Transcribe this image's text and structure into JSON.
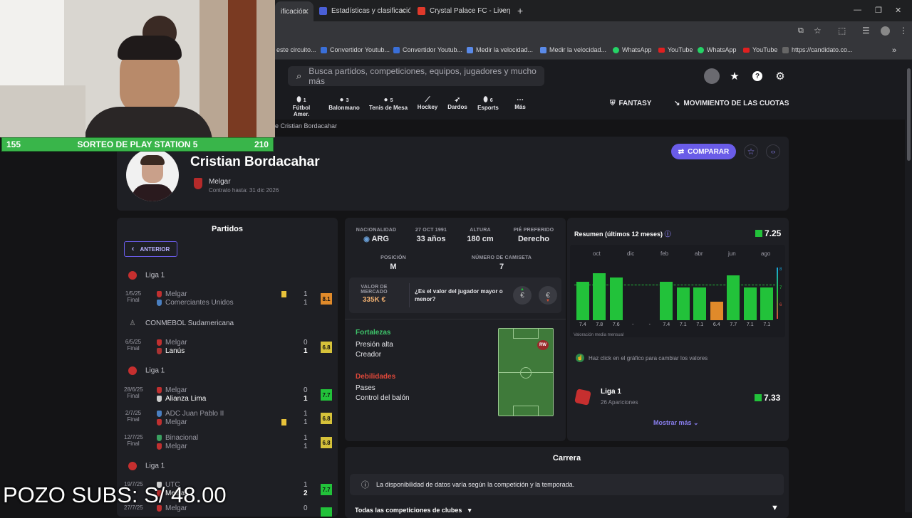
{
  "browser": {
    "tabs": [
      {
        "title": "ificación"
      },
      {
        "title": "Estadísticas y clasificación"
      },
      {
        "title": "Crystal Palace FC - Liverp"
      }
    ],
    "bookmarks": [
      {
        "label": "este circuito..."
      },
      {
        "label": "Convertidor Youtub..."
      },
      {
        "label": "Convertidor Youtub..."
      },
      {
        "label": "Medir la velocidad..."
      },
      {
        "label": "Medir la velocidad..."
      },
      {
        "label": "WhatsApp"
      },
      {
        "label": "YouTube"
      },
      {
        "label": "WhatsApp"
      },
      {
        "label": "YouTube"
      },
      {
        "label": "https://candidato.co..."
      }
    ]
  },
  "overlay": {
    "left_count": "155",
    "banner": "SORTEO DE PLAY STATION 5",
    "right_count": "210",
    "pot": "POZO SUBS: S/ 48.00"
  },
  "header": {
    "search_placeholder": "Busca partidos, competiciones, equipos, jugadores y mucho más",
    "sports": [
      {
        "label": "Fútbol Amer.",
        "count": "1"
      },
      {
        "label": "Balonmano",
        "count": "3"
      },
      {
        "label": "Tenis de Mesa",
        "count": "5"
      },
      {
        "label": "Hockey",
        "count": ""
      },
      {
        "label": "Dardos",
        "count": ""
      },
      {
        "label": "Esports",
        "count": "6"
      },
      {
        "label": "Más",
        "count": ""
      }
    ],
    "fantasy": "FANTASY",
    "odds": "MOVIMIENTO DE LAS CUOTAS"
  },
  "breadcrumb": "e Cristian Bordacahar",
  "player": {
    "name": "Cristian Bordacahar",
    "club": "Melgar",
    "contract": "Contrato hasta: 31 dic 2026",
    "compare": "COMPARAR"
  },
  "matches": {
    "title": "Partidos",
    "prev": "ANTERIOR",
    "groups": [
      {
        "league": "Liga 1",
        "rows": [
          {
            "date": "1/5/25",
            "status": "Final",
            "home": "Melgar",
            "away": "Comerciantes Unidos",
            "hs": "1",
            "as": "1",
            "rating": "8.1",
            "color": "#e08a2a"
          }
        ]
      },
      {
        "league": "CONMEBOL Sudamericana",
        "rows": [
          {
            "date": "6/5/25",
            "status": "Final",
            "home": "Melgar",
            "away": "Lanús",
            "hs": "0",
            "as": "1",
            "rating": "6.8",
            "color": "#d6c23a"
          }
        ]
      },
      {
        "league": "Liga 1",
        "rows": [
          {
            "date": "28/6/25",
            "status": "Final",
            "home": "Melgar",
            "away": "Alianza Lima",
            "hs": "0",
            "as": "1",
            "rating": "7.7",
            "color": "#22c23a"
          },
          {
            "date": "2/7/25",
            "status": "Final",
            "home": "ADC Juan Pablo II",
            "away": "Melgar",
            "hs": "1",
            "as": "1",
            "rating": "6.8",
            "color": "#d6c23a"
          },
          {
            "date": "12/7/25",
            "status": "Final",
            "home": "Binacional",
            "away": "Melgar",
            "hs": "1",
            "as": "1",
            "rating": "6.8",
            "color": "#d6c23a"
          }
        ]
      },
      {
        "league": "Liga 1",
        "rows": [
          {
            "date": "19/7/25",
            "status": "",
            "home": "UTC",
            "away": "Melgar",
            "hs": "1",
            "as": "2",
            "rating": "7.7",
            "color": "#22c23a"
          },
          {
            "date": "27/7/25",
            "status": "",
            "home": "Melgar",
            "away": "",
            "hs": "0",
            "as": "",
            "rating": "",
            "color": "#22c23a"
          }
        ]
      }
    ]
  },
  "info": {
    "nationality_label": "NACIONALIDAD",
    "nationality": "ARG",
    "dob_label": "27 OCT 1991",
    "age": "33 años",
    "height_label": "ALTURA",
    "height": "180 cm",
    "foot_label": "PIÉ PREFERIDO",
    "foot": "Derecho",
    "position_label": "POSICIÓN",
    "position": "M",
    "shirt_label": "NÚMERO DE CAMISETA",
    "shirt": "7",
    "market_label": "VALOR DE MERCADO",
    "market_value": "335K €",
    "market_question": "¿Es el valor del jugador mayor o menor?"
  },
  "strengths": {
    "strengths_title": "Fortalezas",
    "strength1": "Presión alta",
    "strength2": "Creador",
    "weak_title": "Debilidades",
    "weak1": "Pases",
    "weak2": "Control del balón",
    "pos_badge": "RW"
  },
  "summary": {
    "title": "Resumen (últimos 12 meses)",
    "rating": "7.25",
    "months": [
      "oct",
      "dic",
      "feb",
      "abr",
      "jun",
      "ago"
    ],
    "chart_caption": "Valoración media mensual",
    "hint": "Haz click en el gráfico para cambiar los valores",
    "league": "Liga 1",
    "apps": "26 Apariciones",
    "league_rating": "7.33",
    "more": "Mostrar más",
    "scale": [
      "8",
      "7",
      "6"
    ]
  },
  "chart_data": {
    "type": "bar",
    "title": "",
    "categories": [
      "m1",
      "m2",
      "m3",
      "m4",
      "m5",
      "m6",
      "m7",
      "m8",
      "m9",
      "m10",
      "m11",
      "m12"
    ],
    "labels": [
      "7.4",
      "7.8",
      "7.6",
      "-",
      "-",
      "7.4",
      "7.1",
      "7.1",
      "6.4",
      "7.7",
      "7.1",
      "7.1"
    ],
    "values": [
      7.4,
      7.8,
      7.6,
      null,
      null,
      7.4,
      7.1,
      7.1,
      6.4,
      7.7,
      7.1,
      7.1
    ],
    "colors": [
      "#22c23a",
      "#22c23a",
      "#22c23a",
      null,
      null,
      "#22c23a",
      "#22c23a",
      "#22c23a",
      "#e08a2a",
      "#22c23a",
      "#22c23a",
      "#22c23a"
    ],
    "ylim": [
      5.5,
      8.5
    ],
    "average_line": 7.25
  },
  "career": {
    "title": "Carrera",
    "notice": "La disponibilidad de datos varía según la competición y la temporada.",
    "filter": "Todas las competiciones de clubes"
  }
}
